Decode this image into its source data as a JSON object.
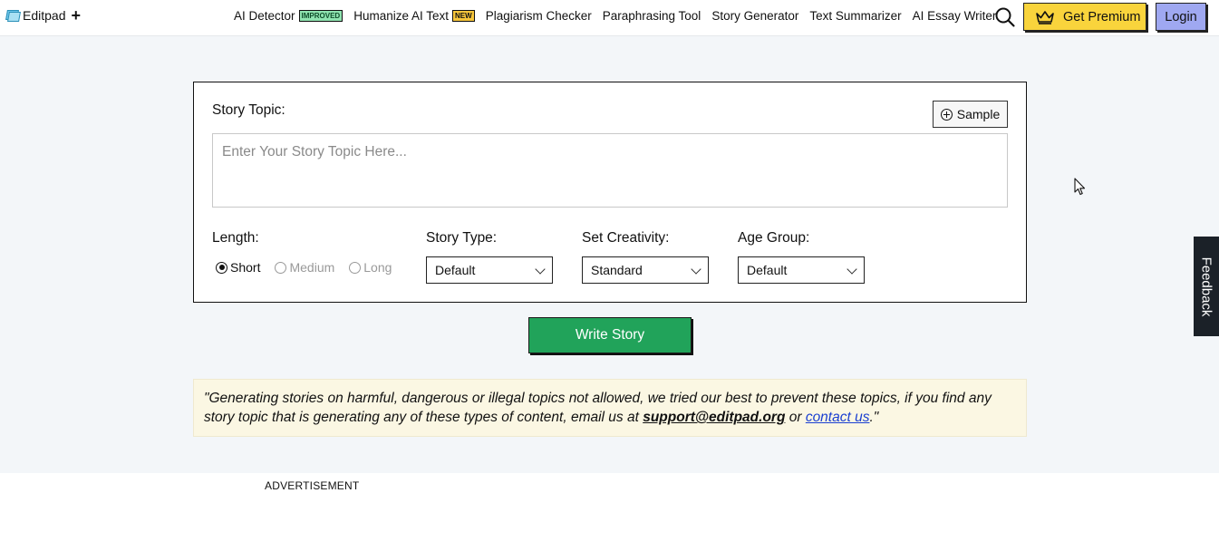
{
  "header": {
    "logo_text": "Editpad",
    "logo_plus": "+",
    "nav": [
      {
        "label": "AI Detector",
        "badge": "IMPROVED"
      },
      {
        "label": "Humanize AI Text",
        "badge": "NEW"
      },
      {
        "label": "Plagiarism Checker"
      },
      {
        "label": "Paraphrasing Tool"
      },
      {
        "label": "Story Generator"
      },
      {
        "label": "Text Summarizer"
      },
      {
        "label": "AI Essay Writer"
      }
    ],
    "premium_label": "Get Premium",
    "login_label": "Login"
  },
  "form": {
    "topic_label": "Story Topic:",
    "sample_label": "Sample",
    "topic_placeholder": "Enter Your Story Topic Here...",
    "topic_value": "",
    "length_label": "Length:",
    "length_options": [
      "Short",
      "Medium",
      "Long"
    ],
    "length_selected": "Short",
    "story_type_label": "Story Type:",
    "story_type_value": "Default",
    "creativity_label": "Set Creativity:",
    "creativity_value": "Standard",
    "age_group_label": "Age Group:",
    "age_group_value": "Default",
    "submit_label": "Write Story"
  },
  "notice": {
    "text_before": "\"Generating stories on harmful, dangerous or illegal topics not allowed, we tried our best to prevent these topics, if you find any story topic that is generating any of these types of content, email us at ",
    "email": "support@editpad.org",
    "text_middle": " or ",
    "link": "contact us",
    "text_after": ".\""
  },
  "advertisement_label": "ADVERTISEMENT",
  "feedback_label": "Feedback",
  "colors": {
    "premium": "#f9d43c",
    "login": "#9fa8f1",
    "submit": "#21a35a",
    "notice_bg": "#fbf7e3",
    "page_bg": "#f3f6f9"
  }
}
